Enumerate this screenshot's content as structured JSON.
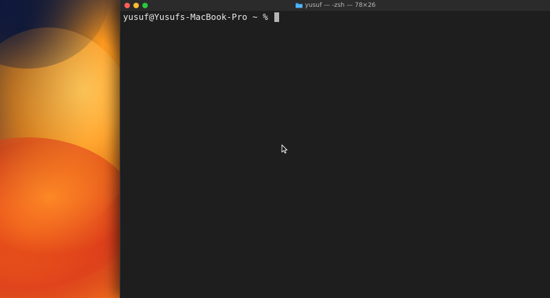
{
  "window": {
    "title": "yusuf — -zsh — 78×26",
    "title_icon": "folder-icon"
  },
  "terminal": {
    "prompt": "yusuf@Yusufs-MacBook-Pro ~ % ",
    "input": ""
  },
  "colors": {
    "terminal_bg": "#1e1e1e",
    "titlebar_bg": "#2b2b2b",
    "close": "#ff5f57",
    "minimize": "#febc2e",
    "maximize": "#28c840",
    "folder": "#3aa3f5"
  }
}
